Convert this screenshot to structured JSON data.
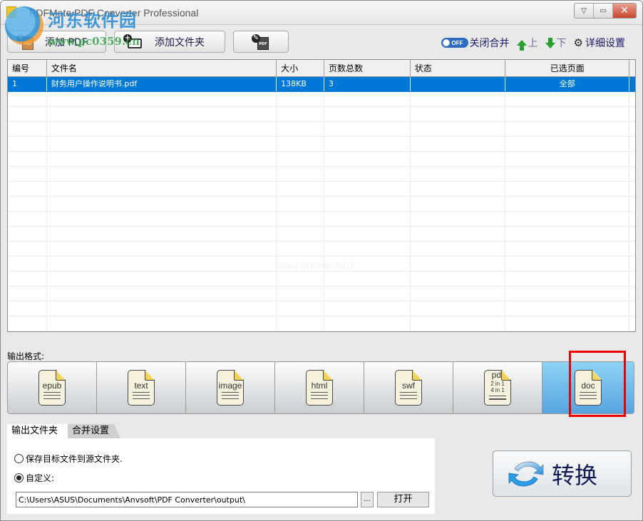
{
  "window": {
    "title": "PDFMate PDF Converter Professional",
    "controls": {
      "menu": "▽",
      "minimize": "▭",
      "close": "✕"
    }
  },
  "watermark": {
    "site_name": "河东软件园",
    "url": "www.pc0359.cn",
    "table_watermark": "www.pHome.NET"
  },
  "toolbar": {
    "add_pdf": "添加 PDF",
    "add_folder": "添加文件夹",
    "pdf_tool_icon": "pdf-edit-icon",
    "merge_toggle_state": "OFF",
    "merge_toggle_label": "关闭合并",
    "move_up": "上",
    "move_down": "下",
    "advanced_settings": "详细设置"
  },
  "table": {
    "columns": [
      "编号",
      "文件名",
      "大小",
      "页数总数",
      "状态",
      "已选页面"
    ],
    "rows": [
      {
        "index": "1",
        "filename": "财务用户操作说明书.pdf",
        "size": "138KB",
        "pages": "3",
        "status": "",
        "selected_pages": "全部",
        "selected": true
      }
    ],
    "empty_rows": 16
  },
  "output_format": {
    "label": "输出格式:",
    "formats": [
      {
        "id": "epub",
        "label": "epub"
      },
      {
        "id": "text",
        "label": "text"
      },
      {
        "id": "image",
        "label": "image"
      },
      {
        "id": "html",
        "label": "html"
      },
      {
        "id": "swf",
        "label": "swf"
      },
      {
        "id": "pdf",
        "label": "pdf",
        "sub1": "2 in 1",
        "sub2": "4 in 1"
      },
      {
        "id": "doc",
        "label": "doc"
      }
    ],
    "selected": "doc"
  },
  "settings": {
    "tabs": [
      {
        "label": "输出文件夹",
        "active": true
      },
      {
        "label": "合并设置",
        "active": false
      }
    ],
    "option_source": "保存目标文件到源文件夹.",
    "option_custom": "自定义:",
    "selected_option": "custom",
    "output_path": "C:\\Users\\ASUS\\Documents\\Anvsoft\\PDF Converter\\output\\",
    "browse_label": "...",
    "open_label": "打开"
  },
  "convert": {
    "label": "转换"
  },
  "colors": {
    "selection": "#0078d7",
    "active_format": "#6cb8e8",
    "highlight": "#ee0000",
    "link_text": "#1b1b6a",
    "arrow_green": "#27a12e"
  }
}
